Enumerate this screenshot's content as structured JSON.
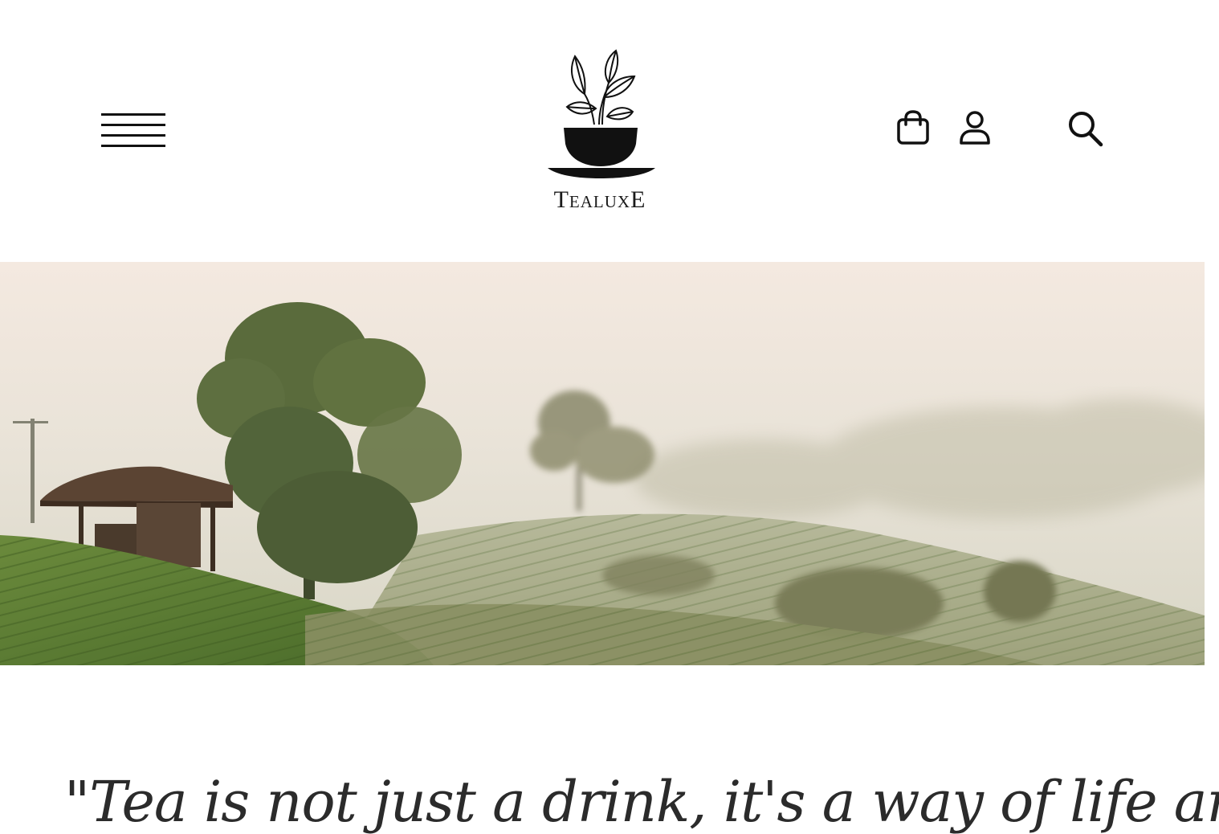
{
  "header": {
    "menu_icon": "hamburger-menu-icon",
    "logo": {
      "icon": "tea-cup-leaves-logo",
      "wordmark": "TealuxE"
    },
    "actions": [
      {
        "icon": "shopping-bag-icon"
      },
      {
        "icon": "user-account-icon"
      },
      {
        "icon": "search-icon"
      }
    ]
  },
  "hero": {
    "image": "misty-tea-plantation-hills"
  },
  "quote": {
    "text": "\"Tea is not just a drink, it's a way of life and"
  },
  "colors": {
    "icon": "#111111",
    "text": "#2b2b2b",
    "background": "#ffffff"
  }
}
